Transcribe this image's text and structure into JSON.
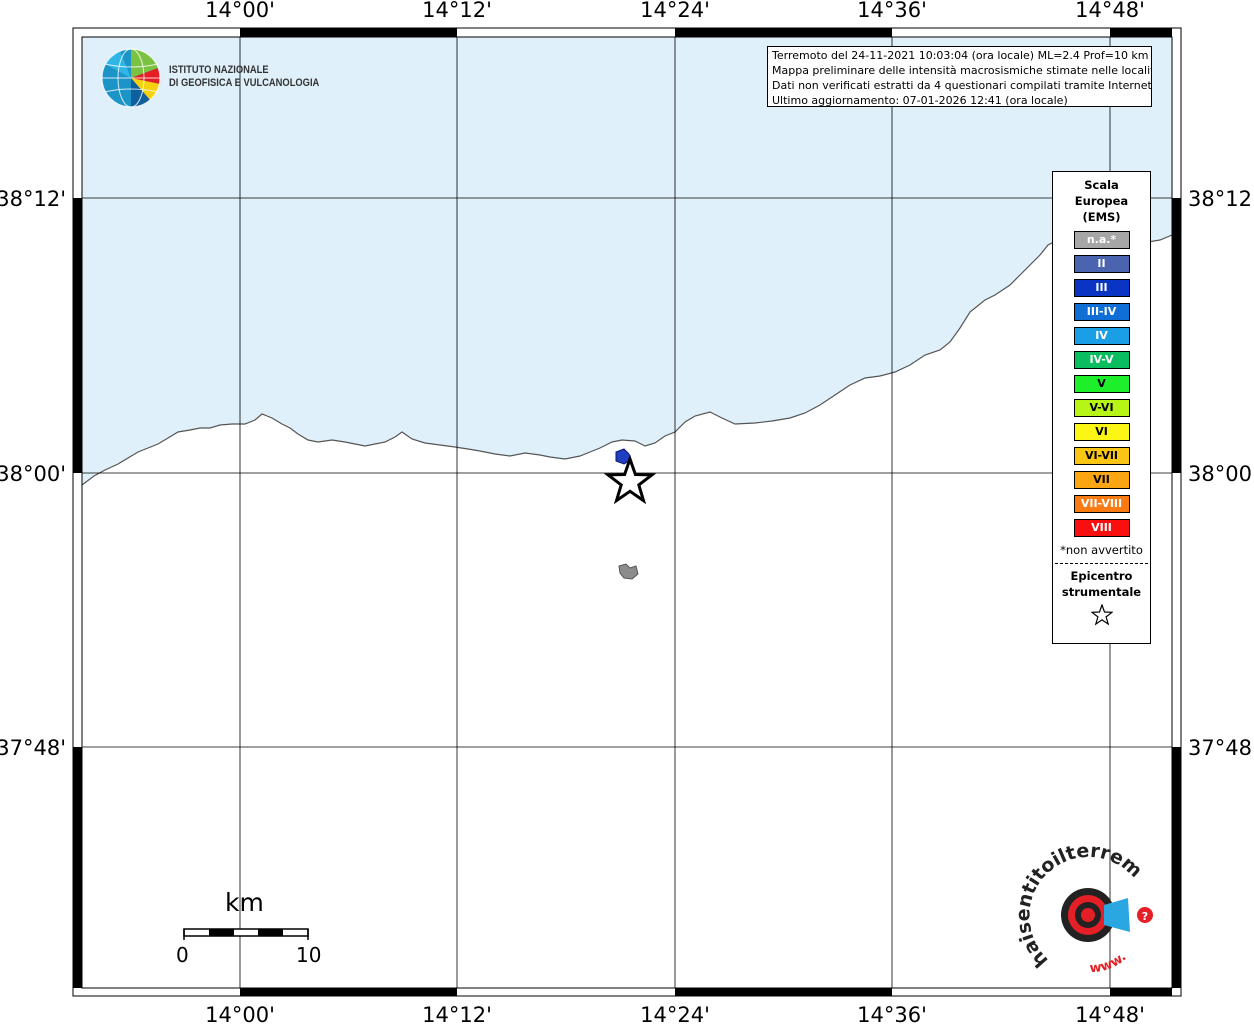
{
  "map": {
    "lon_ticks_top": [
      "14°00'",
      "14°12'",
      "14°24'",
      "14°36'",
      "14°48'"
    ],
    "lon_ticks_bottom": [
      "14°00'",
      "14°12'",
      "14°24'",
      "14°36'",
      "14°48'"
    ],
    "lat_ticks_left": [
      "38°12'",
      "38°00'",
      "37°48'"
    ],
    "lat_ticks_right": [
      "38°12'",
      "38°00'",
      "37°48'"
    ],
    "sea_color": "#dff0fb",
    "land_color": "#ffffff",
    "coast_color": "#555555"
  },
  "info": {
    "line1": "Terremoto del 24-11-2021 10:03:04 (ora locale) ML=2.4 Prof=10 km",
    "line2": "Mappa preliminare delle intensità macrosismiche stimate nelle località",
    "line3": "Dati non verificati estratti da 4 questionari compilati tramite Internet.",
    "line4": "Ultimo aggiornamento: 07-01-2026 12:41 (ora locale)"
  },
  "legend": {
    "title_line1": "Scala",
    "title_line2": "Europea",
    "title_line3": "(EMS)",
    "items": [
      {
        "label": "n.a.*",
        "color": "#a6a6a6"
      },
      {
        "label": "II",
        "color": "#4a64b0"
      },
      {
        "label": "III",
        "color": "#0a35c4"
      },
      {
        "label": "III-IV",
        "color": "#0f6fd6"
      },
      {
        "label": "IV",
        "color": "#1a9ee6"
      },
      {
        "label": "IV-V",
        "color": "#0abd5e"
      },
      {
        "label": "V",
        "color": "#1df02a"
      },
      {
        "label": "V-VI",
        "color": "#b7f516"
      },
      {
        "label": "VI",
        "color": "#fbf614"
      },
      {
        "label": "VI-VII",
        "color": "#fbc513"
      },
      {
        "label": "VII",
        "color": "#fba513"
      },
      {
        "label": "VII-VIII",
        "color": "#fb7b13"
      },
      {
        "label": "VIII",
        "color": "#f90f0f"
      }
    ],
    "note": "*non avvertito",
    "epicenter_line1": "Epicentro",
    "epicenter_line2": "strumentale"
  },
  "logo": {
    "line1": "ISTITUTO NAZIONALE",
    "line2": "DI GEOFISICA E VULCANOLOGIA"
  },
  "scale_bar": {
    "unit": "km",
    "start": "0",
    "end": "10"
  },
  "haisentito": {
    "text": "haisentitoilterremoto.it",
    "www": "www."
  }
}
